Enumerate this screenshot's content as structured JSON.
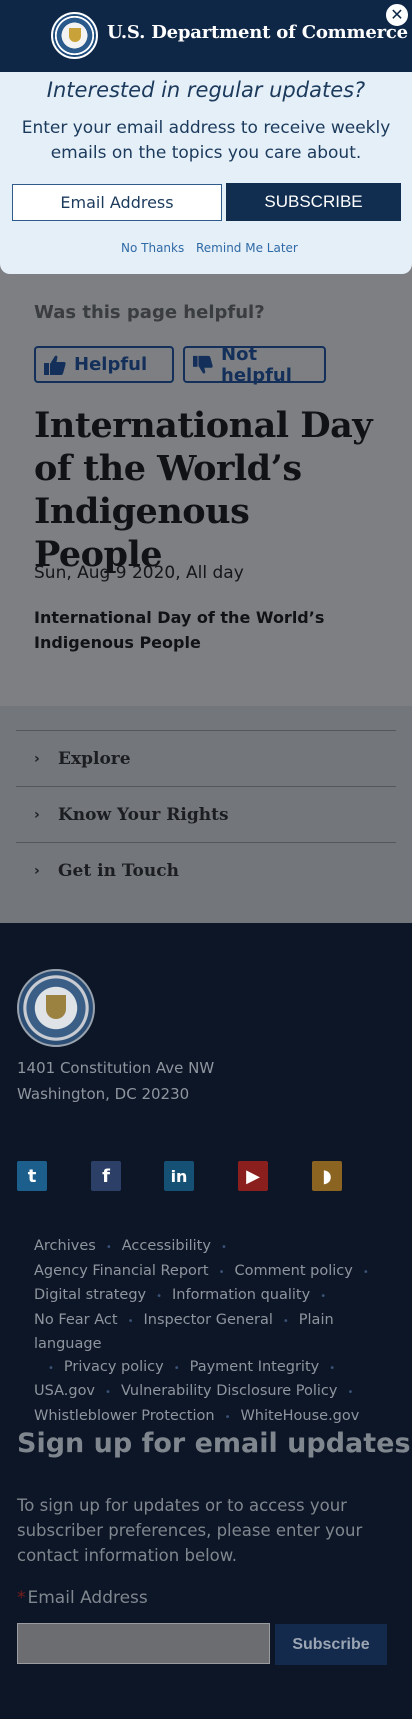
{
  "modal": {
    "title": "U.S. Department of Commerce",
    "close_glyph": "✕",
    "question": "Interested in regular updates?",
    "description": "Enter your email address to receive weekly emails on the topics you care about.",
    "email_placeholder": "Email Address",
    "subscribe_label": "SUBSCRIBE",
    "no_thanks_label": "No Thanks",
    "remind_later_label": "Remind Me Later"
  },
  "helpful": {
    "question": "Was this page helpful?",
    "helpful_label": "Helpful",
    "not_helpful_label": "Not helpful"
  },
  "event": {
    "title": "International Day of the World’s Indigenous People",
    "date": "Sun, Aug 9 2020, All day",
    "description": "International Day of the World’s Indigenous People"
  },
  "accordion": {
    "items": [
      {
        "label": "Explore"
      },
      {
        "label": "Know Your Rights"
      },
      {
        "label": "Get in Touch"
      }
    ]
  },
  "footer": {
    "address_line1": "1401 Constitution Ave NW",
    "address_line2": "Washington, DC 20230",
    "social": [
      {
        "icon": "twitter-icon",
        "glyph": "t"
      },
      {
        "icon": "facebook-icon",
        "glyph": "f"
      },
      {
        "icon": "linkedin-icon",
        "glyph": "in"
      },
      {
        "icon": "youtube-icon",
        "glyph": "▶"
      },
      {
        "icon": "rss-icon",
        "glyph": "◗"
      }
    ],
    "links": [
      "Archives",
      "Accessibility",
      "Agency Financial Report",
      "Comment policy",
      "Digital strategy",
      "Information quality",
      "No Fear Act",
      "Inspector General",
      "Plain language",
      "Privacy policy",
      "Payment Integrity",
      "USA.gov",
      "Vulnerability Disclosure Policy",
      "Whistleblower Protection",
      "WhiteHouse.gov"
    ],
    "signup_heading": "Sign up for email updates",
    "signup_text": "To sign up for updates or to access your subscriber preferences, please enter your contact information below.",
    "email_required_mark": "*",
    "email_label": "Email Address",
    "subscribe_label": "Subscribe"
  },
  "colors": {
    "navy": "#0f2747",
    "modal_bg": "#e5eff8",
    "footer_bg": "#0c1627",
    "link_blue": "#2f6aa6"
  }
}
